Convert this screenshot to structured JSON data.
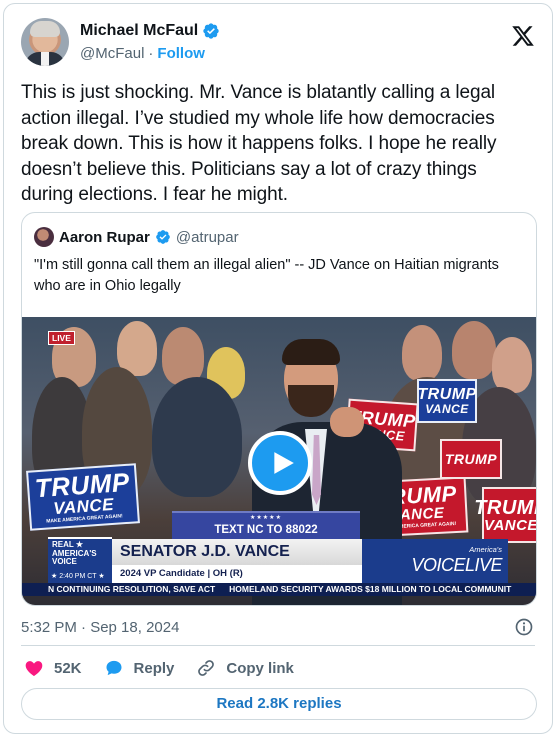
{
  "author": {
    "name": "Michael McFaul",
    "handle": "@McFaul",
    "separator": "·",
    "follow_label": "Follow"
  },
  "tweet": {
    "text": "This is just shocking. Mr. Vance is blatantly calling a legal action illegal. I’ve studied my whole life how democracies break down. This is how it happens folks. I hope he really doesn’t believe this. Politicians say a lot of crazy things during elections. I fear he might.",
    "timestamp": "5:32 PM · Sep 18, 2024"
  },
  "quoted_tweet": {
    "name": "Aaron Rupar",
    "handle": "@atrupar",
    "text": "\"I'm still gonna call them an illegal alien\" -- JD Vance on Haitian migrants who are in Ohio legally",
    "video": {
      "live_badge": "LIVE",
      "sign_top": "TRUMP",
      "sign_bottom": "VANCE",
      "sign_tagline": "MAKE AMERICA GREAT AGAIN!",
      "podium_text": "TEXT NC TO 88022",
      "podium_stars": "★★★★★",
      "network_left_top": "REAL ★ AMERICA'S VOICE",
      "network_time": "★ 2:40 PM CT ★",
      "lower_third_title": "SENATOR J.D. VANCE",
      "lower_third_subtitle": "2024 VP Candidate | OH (R)",
      "brand_small": "America's",
      "brand_big": "VOICELIVE",
      "ticker_left": "N CONTINUING RESOLUTION, SAVE ACT",
      "ticker_right": "HOMELAND SECURITY AWARDS $18 MILLION TO LOCAL COMMUNIT"
    }
  },
  "actions": {
    "likes": "52K",
    "reply_label": "Reply",
    "copy_link_label": "Copy link"
  },
  "read_replies_label": "Read 2.8K replies",
  "colors": {
    "accent": "#1d9bf0",
    "heart": "#f91880",
    "muted": "#536471"
  },
  "icons": [
    "verified-badge-icon",
    "x-logo-icon",
    "play-icon",
    "info-icon",
    "heart-icon",
    "reply-bubble-icon",
    "link-icon"
  ]
}
